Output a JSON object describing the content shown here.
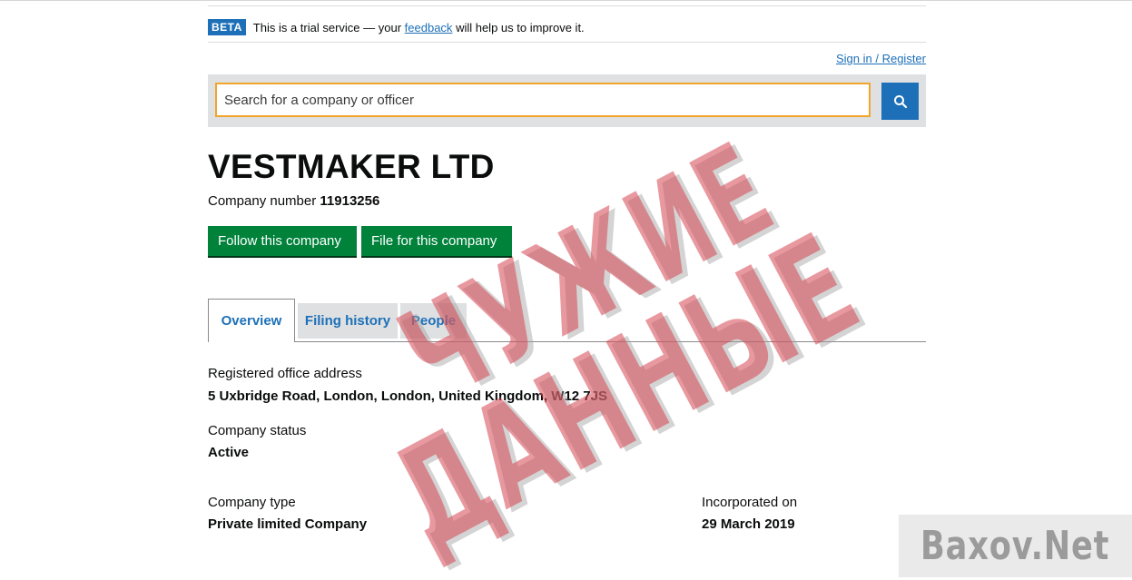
{
  "beta": {
    "tag": "BETA",
    "text_before": "This is a trial service — your",
    "link": "feedback",
    "text_after": "will help us to improve it."
  },
  "header": {
    "signin": "Sign in / Register"
  },
  "search": {
    "placeholder": "Search for a company or officer",
    "button_icon": "search-icon"
  },
  "company": {
    "name": "VESTMAKER LTD",
    "number_label": "Company number",
    "number": "11913256"
  },
  "actions": {
    "follow": "Follow this company",
    "file": "File for this company"
  },
  "tabs": [
    {
      "label": "Overview",
      "active": true
    },
    {
      "label": "Filing history",
      "active": false
    },
    {
      "label": "People",
      "active": false
    }
  ],
  "overview": {
    "address_label": "Registered office address",
    "address": "5 Uxbridge Road, London, London, United Kingdom, W12 7JS",
    "status_label": "Company status",
    "status": "Active",
    "type_label": "Company type",
    "type": "Private limited Company",
    "incorporated_label": "Incorporated on",
    "incorporated": "29 March 2019"
  },
  "stamp": {
    "line1": "ЧУЖИЕ",
    "line2": "ДАННЫЕ"
  },
  "watermark": "Baxov.Net",
  "colors": {
    "link": "#1d70b8",
    "button": "#00823b",
    "search_border": "#f1a52a",
    "stamp": "#d64650"
  }
}
